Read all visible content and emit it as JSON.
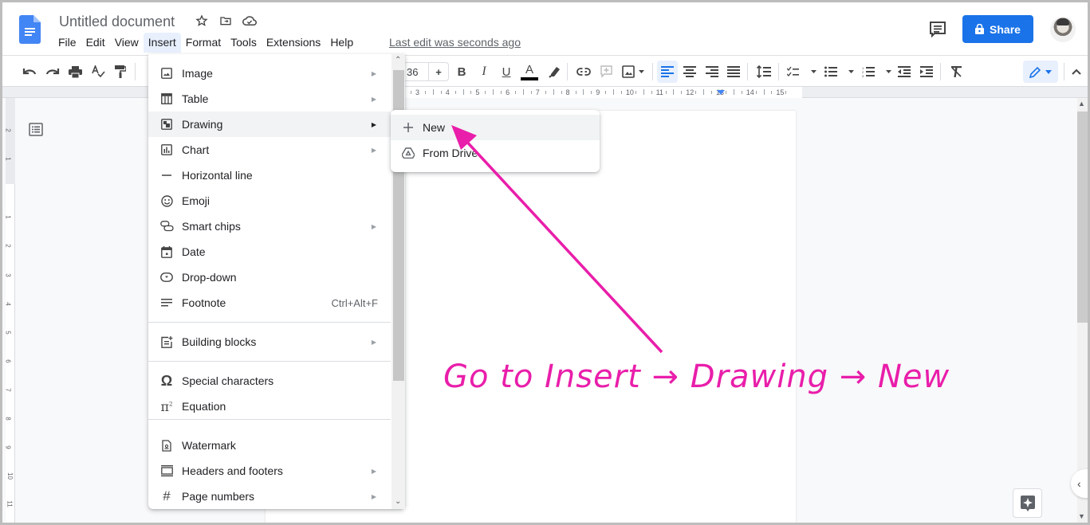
{
  "app": {
    "title": "Untitled document",
    "menu": [
      "File",
      "Edit",
      "View",
      "Insert",
      "Format",
      "Tools",
      "Extensions",
      "Help"
    ],
    "active_menu": "Insert",
    "last_edit": "Last edit was seconds ago",
    "share_label": "Share",
    "brand_color": "#1a73e8"
  },
  "toolbar": {
    "font_size": "36",
    "font_size_plus": "+",
    "bold": "B",
    "italic": "I",
    "underline": "U",
    "text_color": "A"
  },
  "ruler": {
    "numbers": [
      "3",
      "4",
      "5",
      "6",
      "7",
      "8",
      "9",
      "10",
      "11",
      "12",
      "13",
      "14",
      "15"
    ]
  },
  "vruler": {
    "numbers": [
      "2",
      "1",
      "1",
      "2",
      "3",
      "4",
      "5",
      "6",
      "7",
      "8",
      "9",
      "10",
      "11"
    ]
  },
  "insert_menu": {
    "items": [
      {
        "label": "Image",
        "icon": "image-icon",
        "submenu": true
      },
      {
        "label": "Table",
        "icon": "table-icon",
        "submenu": true
      },
      {
        "label": "Drawing",
        "icon": "drawing-icon",
        "submenu": true,
        "highlighted": true
      },
      {
        "label": "Chart",
        "icon": "chart-icon",
        "submenu": true
      },
      {
        "label": "Horizontal line",
        "icon": "horizontal-line-icon"
      },
      {
        "label": "Emoji",
        "icon": "emoji-icon"
      },
      {
        "label": "Smart chips",
        "icon": "smart-chips-icon",
        "submenu": true
      },
      {
        "label": "Date",
        "icon": "calendar-icon"
      },
      {
        "label": "Drop-down",
        "icon": "dropdown-icon"
      },
      {
        "label": "Footnote",
        "icon": "footnote-icon",
        "shortcut": "Ctrl+Alt+F"
      },
      {
        "label": "Building blocks",
        "icon": "building-blocks-icon",
        "submenu": true
      },
      {
        "label": "Special characters",
        "icon": "omega-icon"
      },
      {
        "label": "Equation",
        "icon": "pi-icon"
      },
      {
        "label": "Watermark",
        "icon": "watermark-icon"
      },
      {
        "label": "Headers and footers",
        "icon": "headers-footers-icon",
        "submenu": true
      },
      {
        "label": "Page numbers",
        "icon": "hash-icon",
        "submenu": true
      }
    ]
  },
  "drawing_submenu": {
    "items": [
      {
        "label": "New",
        "icon": "plus-icon",
        "highlighted": true
      },
      {
        "label": "From Drive",
        "icon": "drive-icon"
      }
    ]
  },
  "annotation": {
    "text": "Go to Insert → Drawing → New",
    "color": "#e91eaa"
  }
}
